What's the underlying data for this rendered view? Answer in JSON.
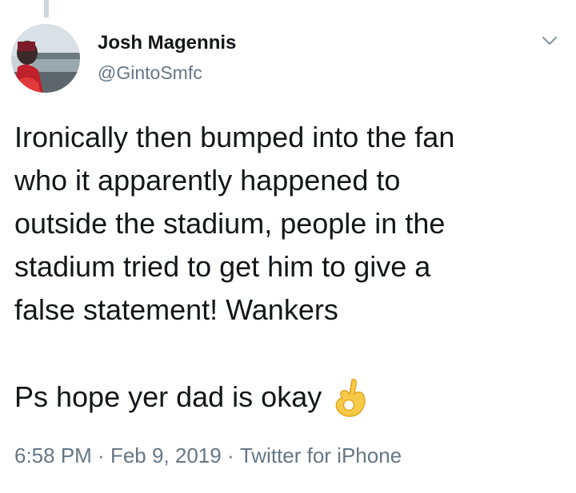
{
  "author": {
    "display_name": "Josh Magennis",
    "handle": "@GintoSmfc"
  },
  "tweet": {
    "text": "Ironically then bumped into the fan\nwho it apparently happened to\noutside the stadium, people in the\nstadium tried to get him to give a\nfalse statement! Wankers",
    "ps_text": "Ps hope yer dad is okay",
    "emoji": "ok-hand"
  },
  "meta": {
    "time": "6:58 PM",
    "separator": " · ",
    "date": "Feb 9, 2019",
    "source": "Twitter for iPhone"
  },
  "icons": {
    "menu": "chevron-down-icon",
    "emoji_color": "#f7c948"
  }
}
